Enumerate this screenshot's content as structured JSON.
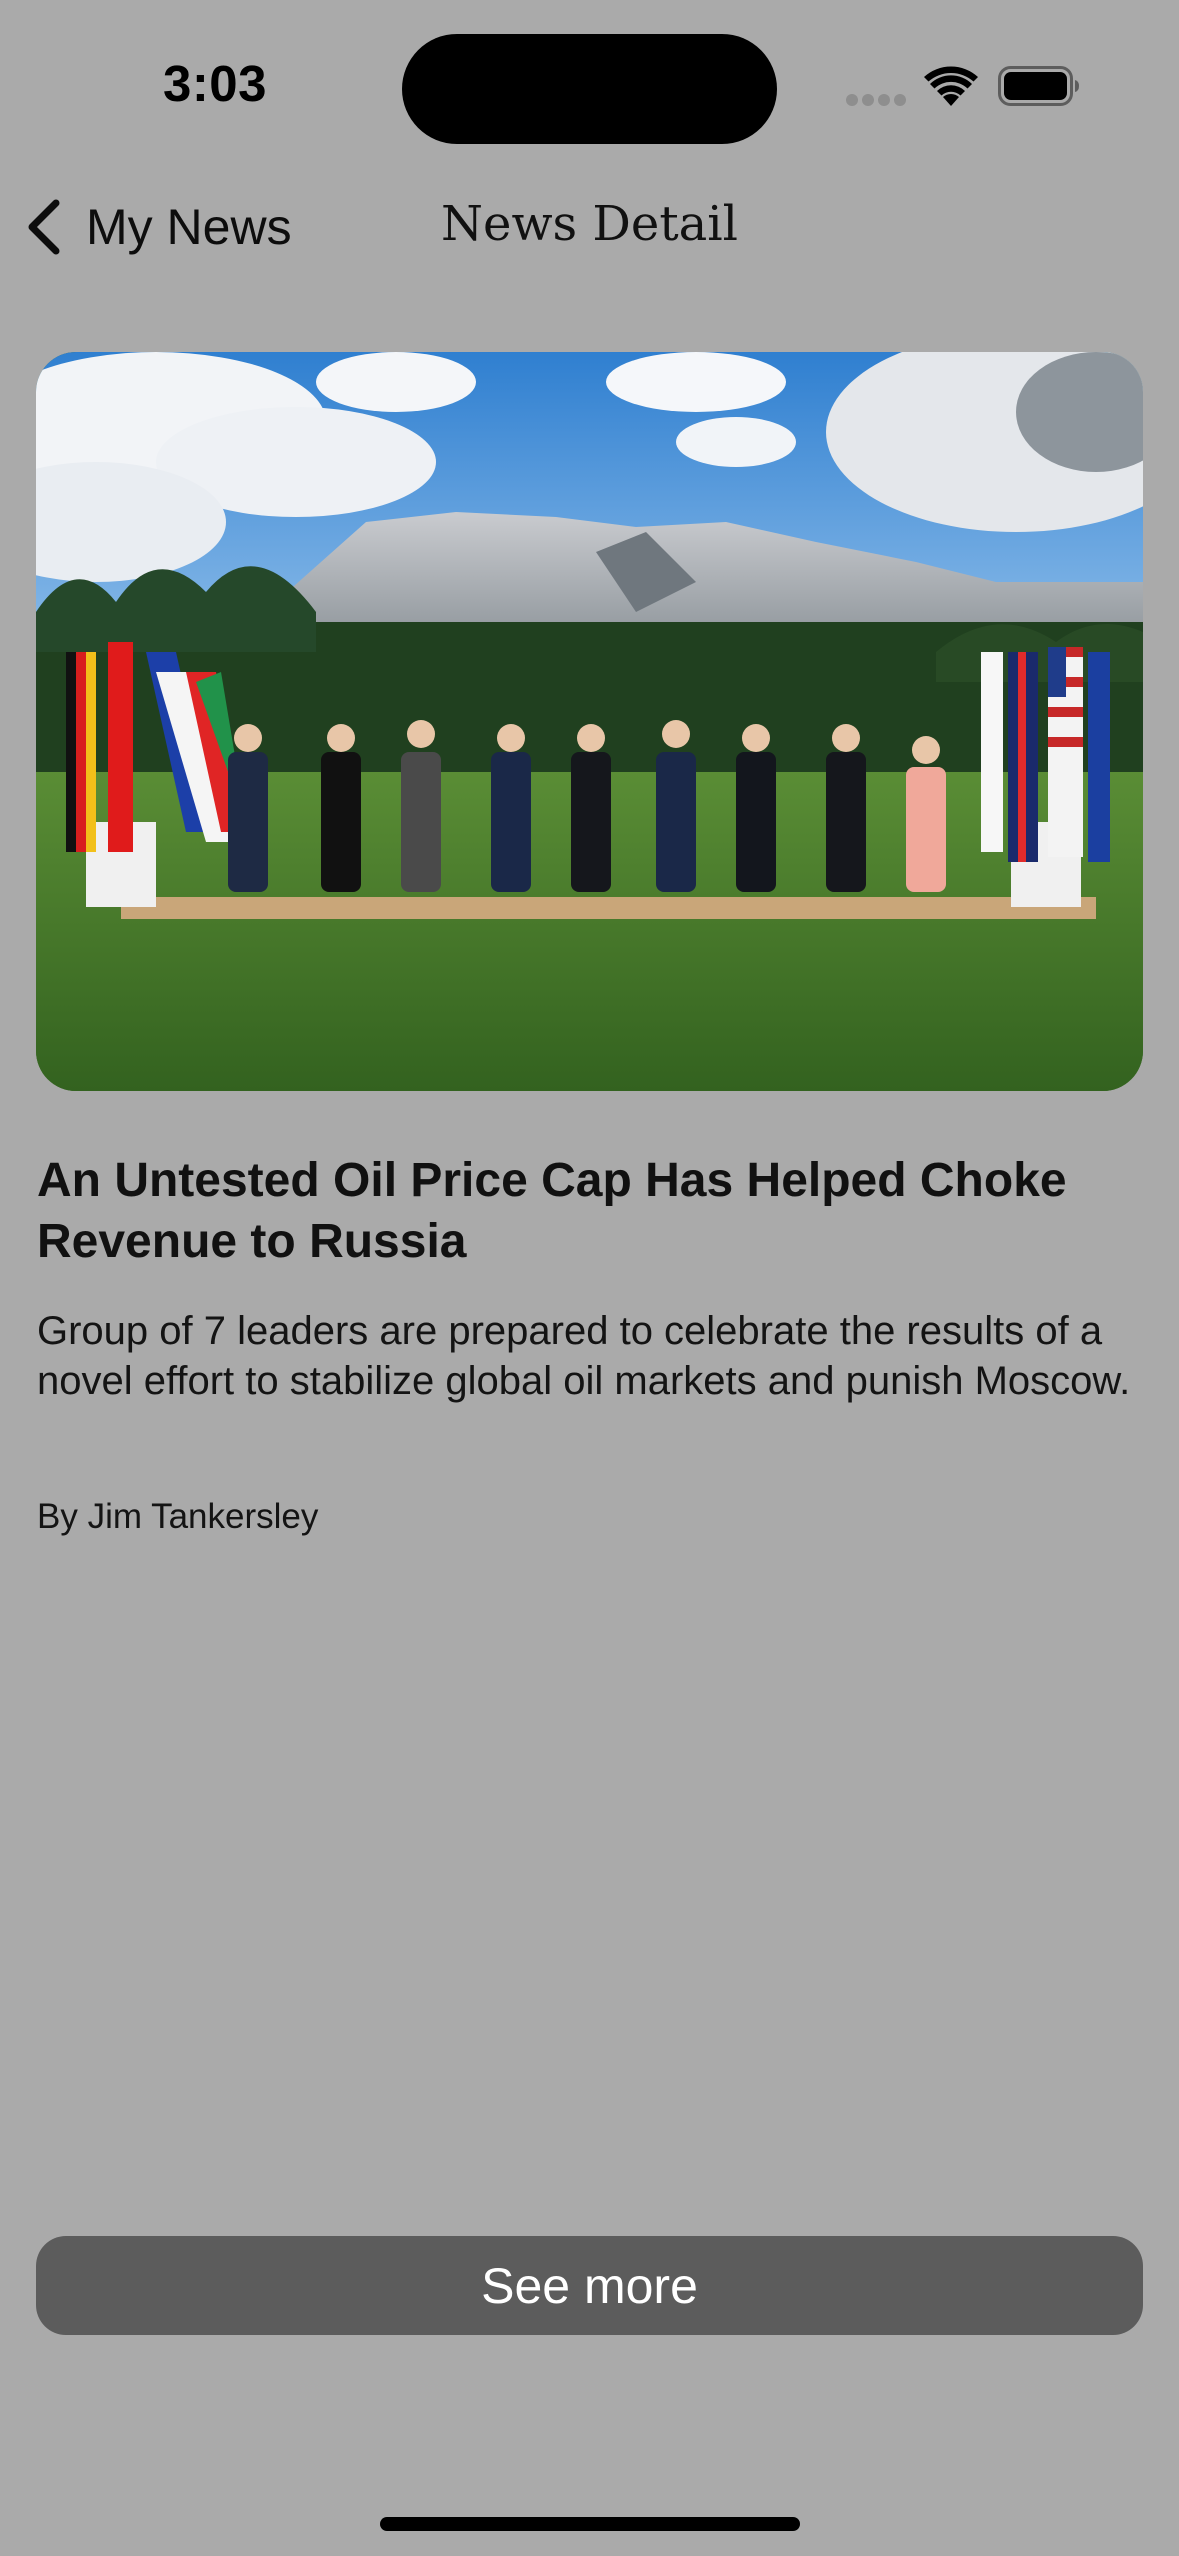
{
  "status_bar": {
    "time": "3:03"
  },
  "nav": {
    "back_label": "My News",
    "title": "News Detail"
  },
  "article": {
    "image_alt": "G7 leaders photo",
    "headline": "An Untested Oil Price Cap Has Helped Choke Revenue to Russia",
    "summary": "Group of 7 leaders are prepared to celebrate the results of a novel effort to stabilize global oil markets and punish Moscow.",
    "byline": "By Jim Tankersley"
  },
  "actions": {
    "see_more_label": "See more"
  },
  "colors": {
    "background": "#aaaaaa",
    "button": "#5c5c5c",
    "button_text": "#ffffff"
  }
}
